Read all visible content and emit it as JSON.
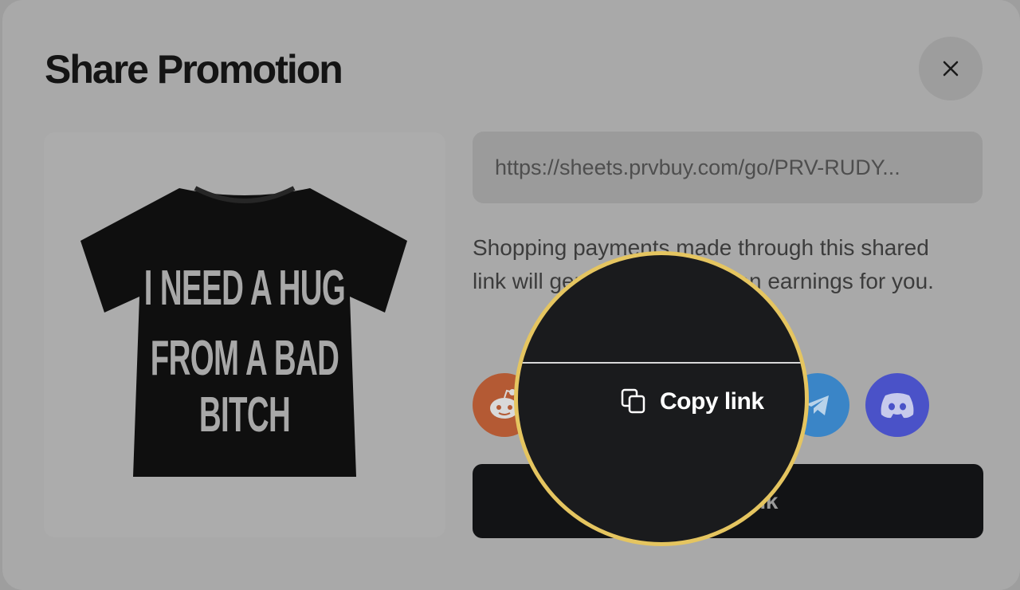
{
  "modal": {
    "title": "Share Promotion",
    "close_icon": "close-icon"
  },
  "product": {
    "image": "black t-shirt",
    "shirt_text_line1": "I NEED A HUG",
    "shirt_text_line2": "FROM A BAD BITCH"
  },
  "share": {
    "link_value": "https://sheets.prvbuy.com/go/PRV-RUDY...",
    "description": "Shopping payments made through this shared link will generate commission earnings for you.",
    "social_icons": [
      "reddit-icon",
      "telegram-icon",
      "discord-icon"
    ],
    "primary_button_label": "Copy link"
  },
  "magnifier": {
    "copy_label": "Copy link",
    "copy_icon": "copy-icon",
    "ring_color": "#e5c560"
  },
  "colors": {
    "button_bg": "#121315",
    "reddit": "#b45a34",
    "telegram": "#3a85c7",
    "discord": "#4a52c8"
  }
}
